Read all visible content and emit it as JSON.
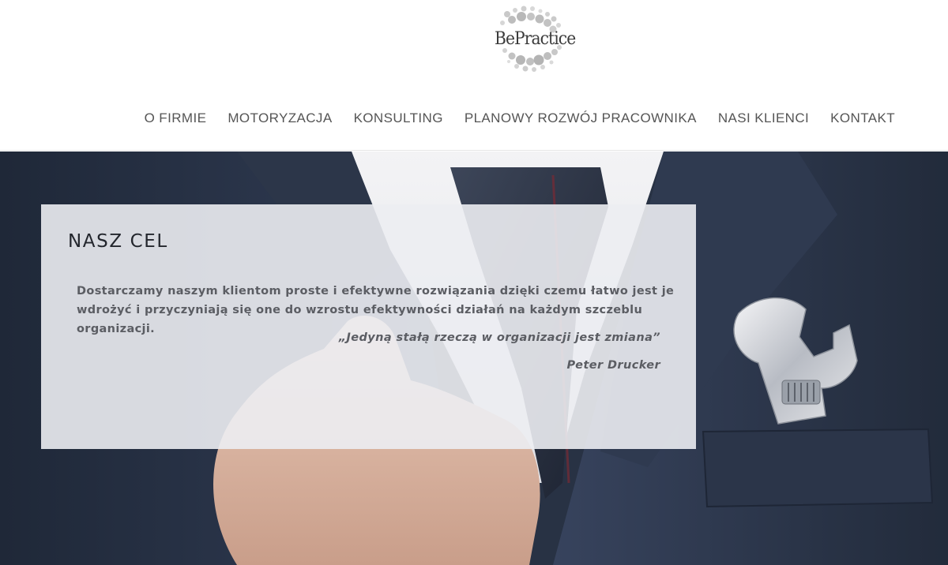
{
  "brand": {
    "logo_text": "BePractice"
  },
  "nav": {
    "items": [
      {
        "label": "O FIRMIE"
      },
      {
        "label": "MOTORYZACJA"
      },
      {
        "label": "KONSULTING"
      },
      {
        "label": "PLANOWY ROZWÓJ PRACOWNIKA"
      },
      {
        "label": "NASI KLIENCI"
      },
      {
        "label": "KONTAKT"
      }
    ]
  },
  "hero": {
    "title": "NASZ CEL",
    "body": "Dostarczamy naszym klientom proste i efektywne rozwiązania dzięki czemu łatwo jest je wdrożyć i przyczyniają się one do wzrostu efektywności działań na każdym szczeblu organizacji.",
    "quote": "„Jedyną stałą rzeczą w organizacji jest zmiana”",
    "author": "Peter Drucker"
  },
  "colors": {
    "nav_text": "#555555",
    "title_text": "#23262d",
    "body_text": "#5b5d63",
    "suit": "#2a3446",
    "panel": "#ecedf2"
  }
}
